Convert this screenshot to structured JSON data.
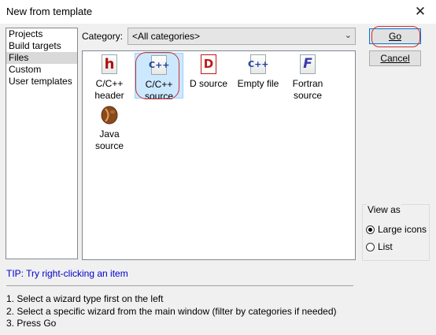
{
  "window": {
    "title": "New from template",
    "close_icon": "close-icon"
  },
  "sidebar": {
    "items": [
      {
        "label": "Projects",
        "selected": false
      },
      {
        "label": "Build targets",
        "selected": false
      },
      {
        "label": "Files",
        "selected": true
      },
      {
        "label": "Custom",
        "selected": false
      },
      {
        "label": "User templates",
        "selected": false
      }
    ]
  },
  "category": {
    "label": "Category:",
    "value": "<All categories>"
  },
  "templates": [
    {
      "label": "C/C++\nheader",
      "icon": "cpp-header-icon",
      "letter": "h",
      "color": "#b01010"
    },
    {
      "label": "C/C++\nsource",
      "icon": "cpp-source-icon",
      "letter": "C++",
      "color": "#1c3f9c",
      "selected": true
    },
    {
      "label": "D source",
      "icon": "d-source-icon",
      "letter": "D",
      "color": "#c01818"
    },
    {
      "label": "Empty file",
      "icon": "empty-file-icon",
      "letter": "C++",
      "color": "#1c3f9c"
    },
    {
      "label": "Fortran\nsource",
      "icon": "fortran-source-icon",
      "letter": "F",
      "color": "#3a3aa8"
    },
    {
      "label": "Java\nsource",
      "icon": "java-source-icon",
      "letter": "",
      "color": "#8b4a1c"
    }
  ],
  "buttons": {
    "go": "Go",
    "cancel": "Cancel"
  },
  "view_as": {
    "legend": "View as",
    "options": [
      "Large icons",
      "List"
    ],
    "selected": "Large icons"
  },
  "tip": "TIP: Try right-clicking an item",
  "instructions": [
    "1. Select a wizard type first on the left",
    "2. Select a specific wizard from the main window (filter by categories if needed)",
    "3. Press Go"
  ]
}
